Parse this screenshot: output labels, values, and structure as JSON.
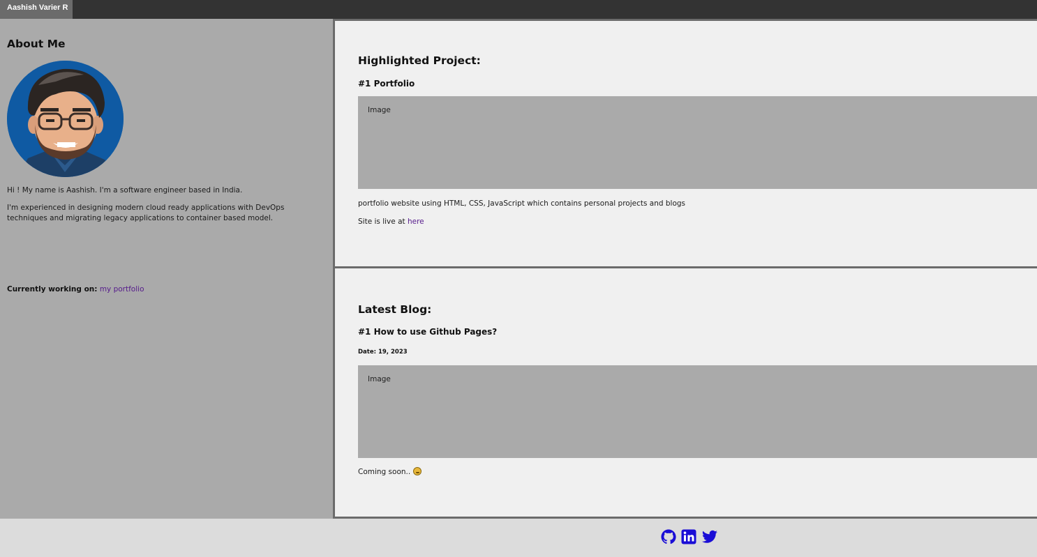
{
  "header": {
    "brand": "Aashish Varier R"
  },
  "sidebar": {
    "title": "About Me",
    "bio": [
      "Hi ! My name is Aashish. I'm a software engineer based in India.",
      "I'm experienced in designing modern cloud ready applications with DevOps techniques and migrating legacy applications to container based model."
    ],
    "working_label": "Currently working on:",
    "working_link": "my portfolio"
  },
  "project": {
    "heading": "Highlighted Project:",
    "title": "#1 Portfolio",
    "image_label": "Image",
    "description": "portfolio website using HTML, CSS, JavaScript which contains personal projects and blogs",
    "live_prefix": "Site is live at",
    "live_link": "here"
  },
  "blog": {
    "heading": "Latest Blog:",
    "title": "#1 How to use Github Pages?",
    "date": "Date: 19, 2023",
    "image_label": "Image",
    "text": "Coming soon.."
  },
  "footer": {
    "icons": [
      "github-icon",
      "linkedin-icon",
      "twitter-icon"
    ]
  },
  "colors": {
    "topbar": "#333333",
    "brand_bg": "#6b6b6b",
    "sidebar_bg": "#aaaaaa",
    "card_bg": "#f0f0f0",
    "social_icon": "#1a0dd6",
    "link_visited": "#551a8b"
  }
}
